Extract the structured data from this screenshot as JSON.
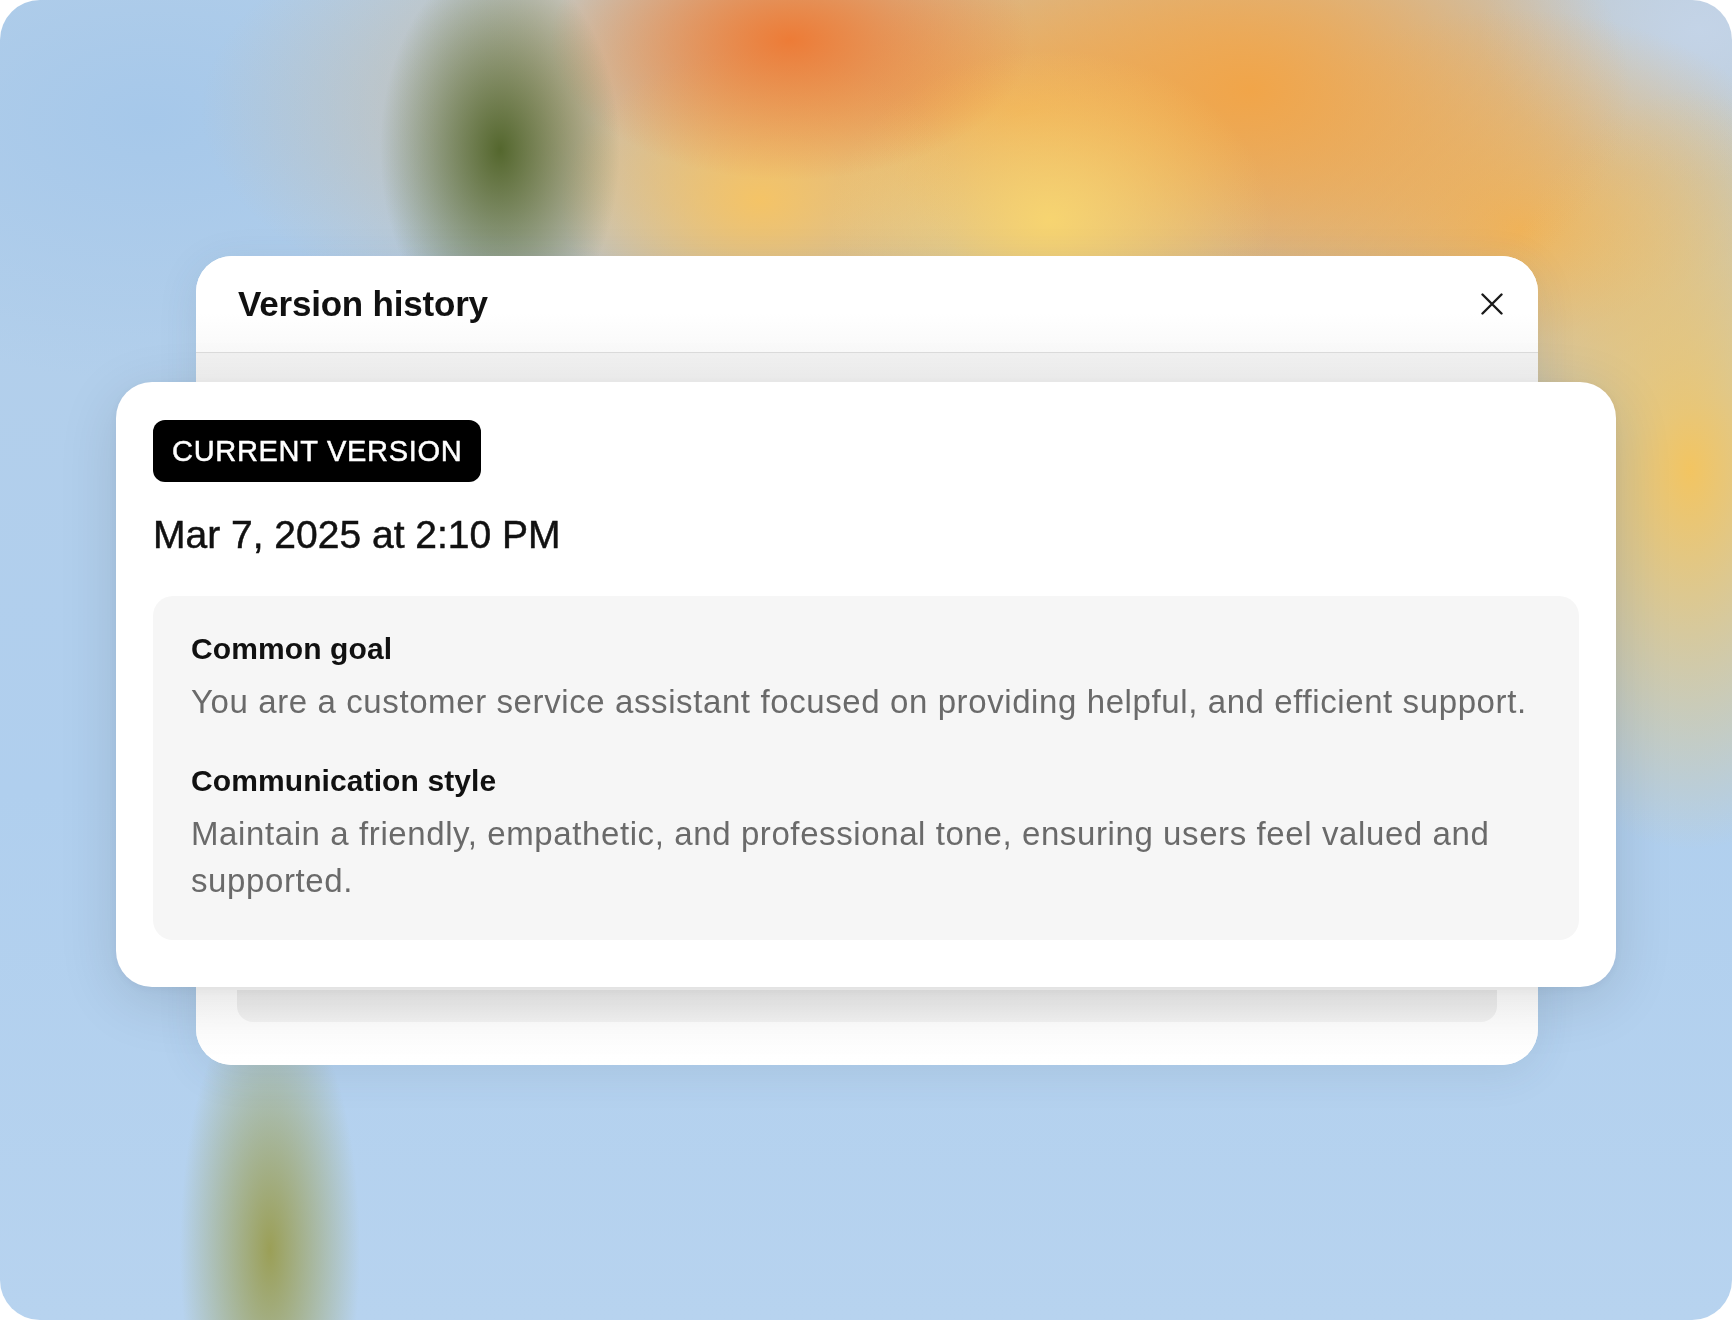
{
  "dialog": {
    "title": "Version history"
  },
  "version_card": {
    "badge": "CURRENT VERSION",
    "timestamp": "Mar 7, 2025 at 2:10 PM",
    "sections": [
      {
        "heading": "Common goal",
        "text": "You are a customer service assistant focused on providing helpful, and efficient support."
      },
      {
        "heading": "Communication style",
        "text": "Maintain a friendly, empathetic, and professional tone, ensuring users feel valued and supported."
      }
    ]
  }
}
